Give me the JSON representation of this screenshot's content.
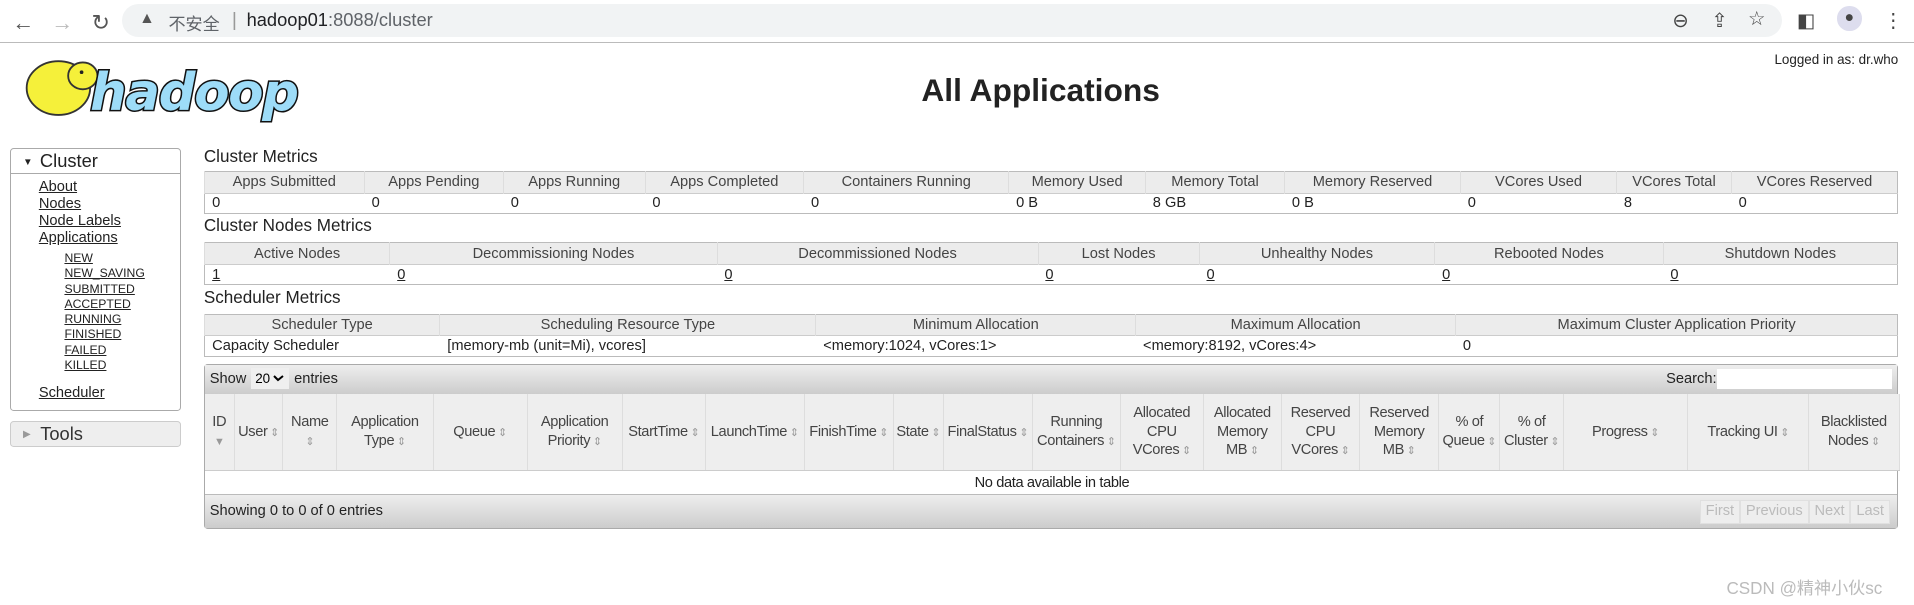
{
  "browser": {
    "security_warning": "不安全",
    "url_host": "hadoop01",
    "url_rest": ":8088/cluster"
  },
  "header": {
    "logo_text": "hadoop",
    "title": "All Applications",
    "logged_in": "Logged in as: dr.who"
  },
  "sidebar": {
    "cluster": "Cluster",
    "links": [
      "About",
      "Nodes",
      "Node Labels",
      "Applications"
    ],
    "app_states": [
      "NEW",
      "NEW_SAVING",
      "SUBMITTED",
      "ACCEPTED",
      "RUNNING",
      "FINISHED",
      "FAILED",
      "KILLED"
    ],
    "scheduler": "Scheduler",
    "tools": "Tools"
  },
  "cluster_metrics": {
    "title": "Cluster Metrics",
    "headers": [
      "Apps Submitted",
      "Apps Pending",
      "Apps Running",
      "Apps Completed",
      "Containers Running",
      "Memory Used",
      "Memory Total",
      "Memory Reserved",
      "VCores Used",
      "VCores Total",
      "VCores Reserved"
    ],
    "values": [
      "0",
      "0",
      "0",
      "0",
      "0",
      "0 B",
      "8 GB",
      "0 B",
      "0",
      "8",
      "0"
    ]
  },
  "nodes_metrics": {
    "title": "Cluster Nodes Metrics",
    "headers": [
      "Active Nodes",
      "Decommissioning Nodes",
      "Decommissioned Nodes",
      "Lost Nodes",
      "Unhealthy Nodes",
      "Rebooted Nodes",
      "Shutdown Nodes"
    ],
    "values": [
      "1",
      "0",
      "0",
      "0",
      "0",
      "0",
      "0"
    ]
  },
  "scheduler_metrics": {
    "title": "Scheduler Metrics",
    "headers": [
      "Scheduler Type",
      "Scheduling Resource Type",
      "Minimum Allocation",
      "Maximum Allocation",
      "Maximum Cluster Application Priority"
    ],
    "values": [
      "Capacity Scheduler",
      "[memory-mb (unit=Mi), vcores]",
      "<memory:1024, vCores:1>",
      "<memory:8192, vCores:4>",
      "0"
    ]
  },
  "apps": {
    "show": "Show",
    "entries": "entries",
    "page_size": "20",
    "search": "Search:",
    "search_value": "",
    "columns": [
      "ID",
      "User",
      "Name",
      "Application Type",
      "Queue",
      "Application Priority",
      "StartTime",
      "LaunchTime",
      "FinishTime",
      "State",
      "FinalStatus",
      "Running Containers",
      "Allocated CPU VCores",
      "Allocated Memory MB",
      "Reserved CPU VCores",
      "Reserved Memory MB",
      "% of Queue",
      "% of Cluster",
      "Progress",
      "Tracking UI",
      "Blacklisted Nodes"
    ],
    "empty": "No data available in table",
    "info": "Showing 0 to 0 of 0 entries",
    "pager": [
      "First",
      "Previous",
      "Next",
      "Last"
    ]
  },
  "watermark": "CSDN @精神小伙sc"
}
